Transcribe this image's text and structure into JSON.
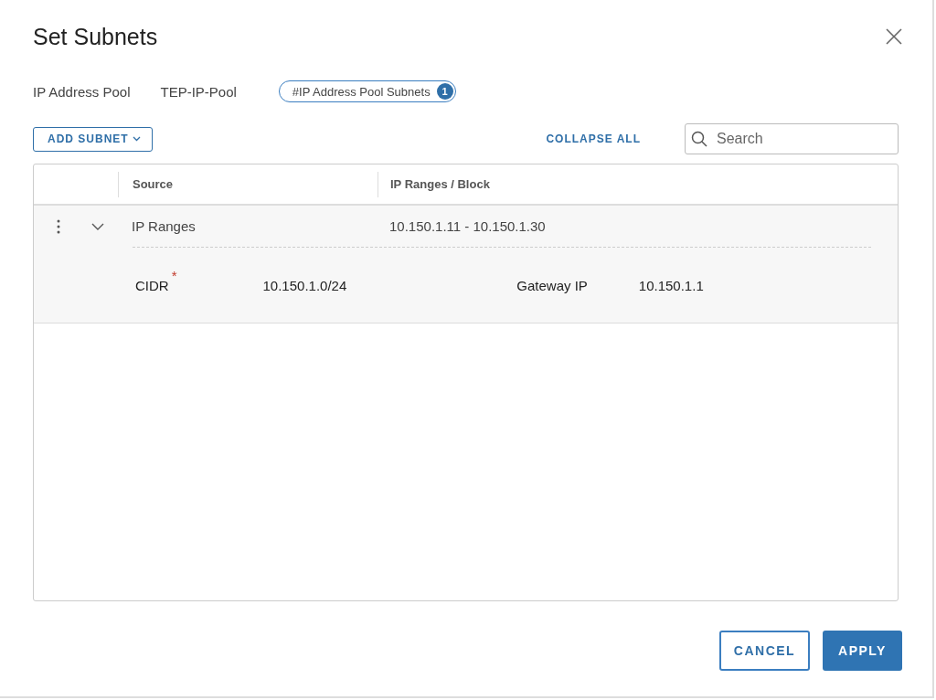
{
  "dialog": {
    "title": "Set Subnets"
  },
  "breadcrumb": [
    "IP Address Pool",
    "TEP-IP-Pool"
  ],
  "tag": {
    "label": "#IP Address Pool Subnets",
    "count": "1"
  },
  "toolbar": {
    "add_button": "ADD SUBNET",
    "collapse_button": "COLLAPSE ALL",
    "search": {
      "placeholder": "Search"
    }
  },
  "table": {
    "columns": [
      "Source",
      "IP Ranges / Block"
    ],
    "rows": [
      {
        "source": "IP Ranges",
        "range": "10.150.1.11 - 10.150.1.30",
        "expanded": true,
        "details": {
          "cidr_label": "CIDR",
          "cidr_mark": "*",
          "cidr": "10.150.1.0/24",
          "gateway_label": "Gateway IP",
          "gateway": "10.150.1.1"
        }
      }
    ]
  },
  "buttons": [
    {
      "label": "CANCEL",
      "kind": "secondary"
    },
    {
      "label": "APPLY",
      "kind": "primary"
    }
  ]
}
